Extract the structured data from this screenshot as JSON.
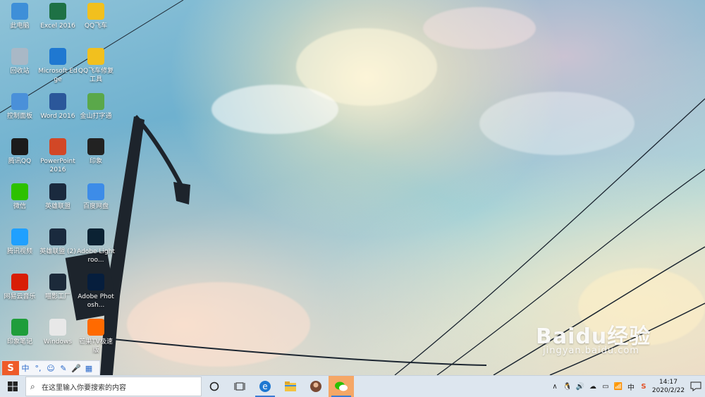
{
  "desktop_icons": [
    {
      "label": "此电脑",
      "icon": "this-pc-icon",
      "color": "#3e8fd8"
    },
    {
      "label": "Excel 2016",
      "icon": "excel-icon",
      "color": "#1e7145"
    },
    {
      "label": "QQ飞车",
      "icon": "qq-speed-icon",
      "color": "#f2c01e"
    },
    {
      "label": "回收站",
      "icon": "recycle-bin-icon",
      "color": "#a9b8c6"
    },
    {
      "label": "Microsoft Edge",
      "icon": "edge-icon",
      "color": "#1f78d1"
    },
    {
      "label": "QQ飞车修复工具",
      "icon": "qq-speed-repair-icon",
      "color": "#f2c01e"
    },
    {
      "label": "控制面板",
      "icon": "control-panel-icon",
      "color": "#4a90d9"
    },
    {
      "label": "Word 2016",
      "icon": "word-icon",
      "color": "#2b579a"
    },
    {
      "label": "金山打字通",
      "icon": "kingsoft-typing-icon",
      "color": "#5aa84a"
    },
    {
      "label": "腾讯QQ",
      "icon": "qq-icon",
      "color": "#1b1b1b"
    },
    {
      "label": "PowerPoint 2016",
      "icon": "powerpoint-icon",
      "color": "#d24726"
    },
    {
      "label": "印象",
      "icon": "yinxiang-icon",
      "color": "#222222"
    },
    {
      "label": "微信",
      "icon": "wechat-icon",
      "color": "#2dc100"
    },
    {
      "label": "英雄联盟",
      "icon": "lol-icon",
      "color": "#1a2a3e"
    },
    {
      "label": "百度网盘",
      "icon": "baidu-netdisk-icon",
      "color": "#3d8ce8"
    },
    {
      "label": "腾讯视频",
      "icon": "tencent-video-icon",
      "color": "#20a0ff"
    },
    {
      "label": "英雄联盟 (2)",
      "icon": "lol-2-icon",
      "color": "#1a2a3e"
    },
    {
      "label": "Adobe Lightroo...",
      "icon": "lightroom-icon",
      "color": "#0b2233"
    },
    {
      "label": "网易云音乐",
      "icon": "netease-music-icon",
      "color": "#d81e06"
    },
    {
      "label": "喵影工厂",
      "icon": "miaoying-icon",
      "color": "#1c2a3a"
    },
    {
      "label": "Adobe Photosh...",
      "icon": "photoshop-icon",
      "color": "#061e3d"
    },
    {
      "label": "印象笔记",
      "icon": "evernote-icon",
      "color": "#1f9d3b"
    },
    {
      "label": "Windows",
      "icon": "windows-file-icon",
      "color": "#e8e8e8"
    },
    {
      "label": "芒果TV极速版",
      "icon": "mangotv-icon",
      "color": "#ff6a00"
    }
  ],
  "ime_bar": {
    "logo": "S",
    "items": [
      "中",
      "°,",
      "☺",
      "✎",
      "🎤",
      "▦"
    ]
  },
  "taskbar": {
    "search_placeholder": "在这里输入你要搜索的内容",
    "apps": [
      {
        "name": "edge",
        "glyph": "e"
      },
      {
        "name": "file-explorer",
        "glyph": "▬"
      },
      {
        "name": "photos",
        "glyph": "●"
      },
      {
        "name": "wechat",
        "glyph": "✉"
      }
    ],
    "tray_items": [
      "∧",
      "🐧",
      "🔊",
      "☁",
      "▭",
      "📶",
      "中",
      "S"
    ],
    "time": "14:17",
    "date": "2020/2/22"
  },
  "watermark": {
    "brand": "Baidu经验",
    "url": "jingyan.baidu.com"
  }
}
